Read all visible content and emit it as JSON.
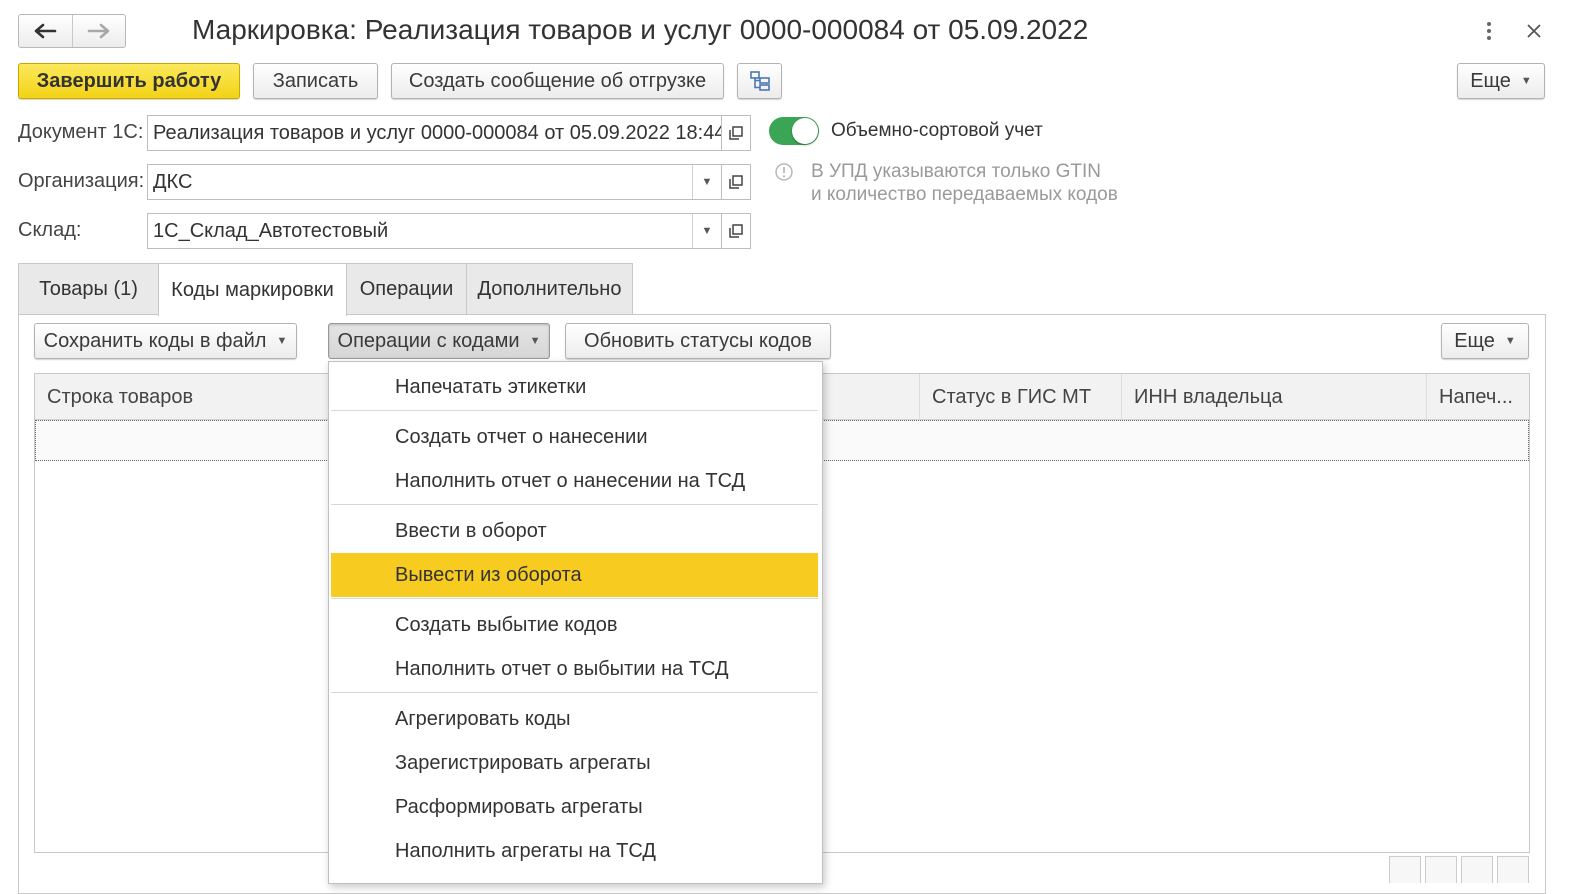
{
  "window": {
    "title": "Маркировка: Реализация товаров и услуг 0000-000084 от 05.09.2022",
    "back_icon": "arrow-left-icon",
    "forward_icon": "arrow-right-icon",
    "menu_icon": "vertical-dots-icon",
    "close_icon": "close-icon"
  },
  "toolbar": {
    "finish_label": "Завершить работу",
    "save_label": "Записать",
    "create_message_label": "Создать сообщение об отгрузке",
    "structure_icon": "structure-icon",
    "more_label": "Еще"
  },
  "form": {
    "document_label": "Документ 1С:",
    "document_value": "Реализация товаров и услуг 0000-000084 от 05.09.2022 18:44:",
    "organization_label": "Организация:",
    "organization_value": "ДКС",
    "warehouse_label": "Склад:",
    "warehouse_value": "1С_Склад_Автотестовый",
    "toggle_label": "Объемно-сортовой учет",
    "toggle_on": true,
    "hint_line1": "В УПД указываются только GTIN",
    "hint_line2": "и количество передаваемых кодов"
  },
  "tabs": [
    {
      "label": "Товары (1)",
      "active": false
    },
    {
      "label": "Коды маркировки",
      "active": true
    },
    {
      "label": "Операции",
      "active": false
    },
    {
      "label": "Дополнительно",
      "active": false
    }
  ],
  "codes_toolbar": {
    "save_codes_label": "Сохранить коды в файл",
    "operations_label": "Операции с кодами",
    "refresh_label": "Обновить статусы кодов",
    "more_label": "Еще"
  },
  "table": {
    "columns": [
      "Строка товаров",
      "Статус в ГИС МТ",
      "ИНН владельца",
      "Напеч..."
    ]
  },
  "menu": {
    "items": [
      "Напечатать этикетки",
      "Создать отчет о нанесении",
      "Наполнить отчет о нанесении на ТСД",
      "Ввести в оборот",
      "Вывести из оборота",
      "Создать выбытие кодов",
      "Наполнить отчет о выбытии на ТСД",
      "Агрегировать коды",
      "Зарегистрировать агрегаты",
      "Расформировать агрегаты",
      "Наполнить агрегаты на ТСД"
    ],
    "highlighted": "Вывести из оборота"
  },
  "colors": {
    "accent_yellow": "#f7cb1f",
    "toggle_green": "#3aa655"
  }
}
